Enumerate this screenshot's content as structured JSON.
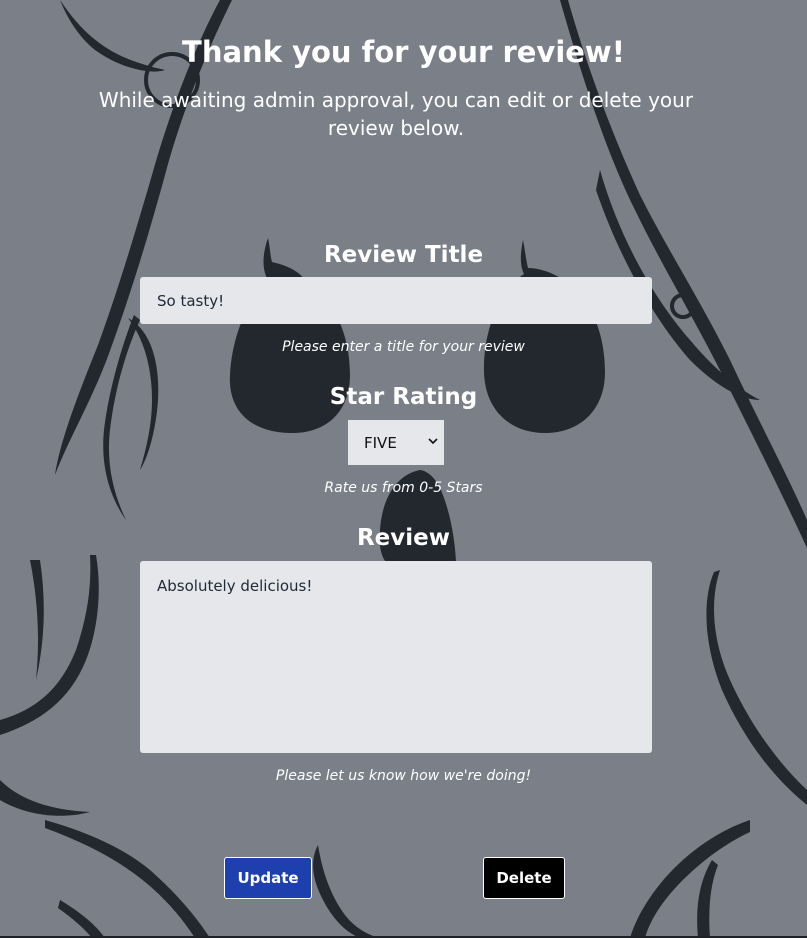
{
  "header": {
    "title": "Thank you for your review!",
    "subtitle": "While awaiting admin approval, you can edit or delete your review below."
  },
  "form": {
    "title_section": {
      "label": "Review Title",
      "value": "So tasty!",
      "hint": "Please enter a title for your review"
    },
    "rating_section": {
      "label": "Star Rating",
      "selected": "FIVE",
      "hint": "Rate us from 0-5 Stars"
    },
    "review_section": {
      "label": "Review",
      "value": "Absolutely delicious!",
      "hint": "Please let us know how we're doing!"
    }
  },
  "actions": {
    "update_label": "Update",
    "delete_label": "Delete"
  },
  "colors": {
    "background": "#7a7f88",
    "artwork": "#23272e",
    "field": "#e5e7eb",
    "update_button": "#1e40af",
    "delete_button": "#000000"
  }
}
